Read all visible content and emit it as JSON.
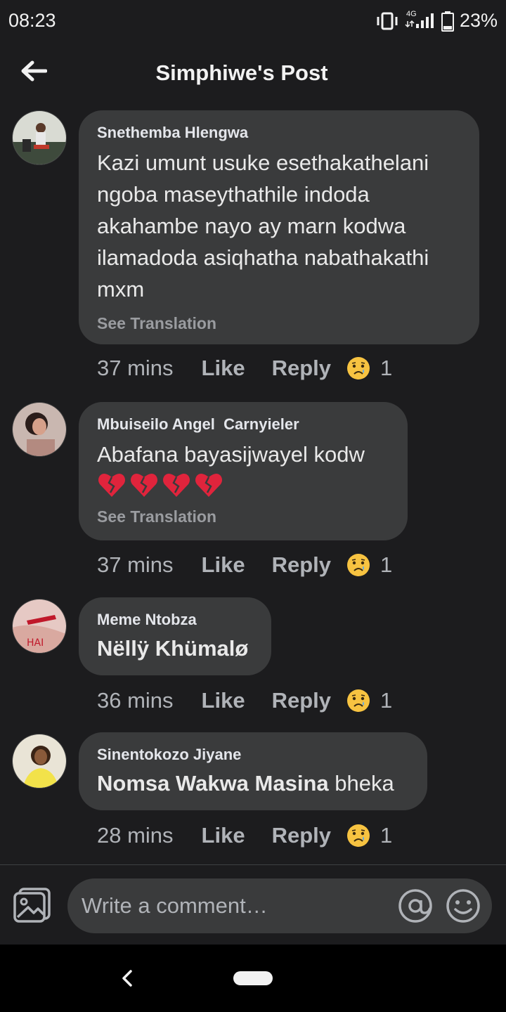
{
  "status": {
    "time": "08:23",
    "network": "4G",
    "battery": "23%"
  },
  "header": {
    "title": "Simphiwe's Post"
  },
  "comments": [
    {
      "author": "Snethemba Hlengwa",
      "text": "Kazi umunt usuke esethakathelani ngoba maseythathile indoda akahambe nayo ay marn kodwa ilamadoda asiqhatha nabathakathi mxm",
      "see_translation": "See Translation",
      "time": "37 mins",
      "like": "Like",
      "reply": "Reply",
      "reaction_count": "1",
      "reaction_icon": "sad-face-icon"
    },
    {
      "author": "Mbuiseilo Angel  Carnyieler",
      "text": "Abafana bayasijwayel kodw",
      "emojis": "💔💔💔💔",
      "see_translation": "See Translation",
      "time": "37 mins",
      "like": "Like",
      "reply": "Reply",
      "reaction_count": "1",
      "reaction_icon": "sad-face-icon"
    },
    {
      "author": "Meme Ntobza",
      "mention": "Nëllÿ Khümalø",
      "time": "36 mins",
      "like": "Like",
      "reply": "Reply",
      "reaction_count": "1",
      "reaction_icon": "sad-face-icon"
    },
    {
      "author": "Sinentokozo Jiyane",
      "mention": "Nomsa Wakwa Masina",
      "text": " bheka",
      "time": "28 mins",
      "like": "Like",
      "reply": "Reply",
      "reaction_count": "1",
      "reaction_icon": "sad-face-icon"
    }
  ],
  "composer": {
    "placeholder": "Write a comment…"
  },
  "colors": {
    "background": "#1c1c1e",
    "bubble": "#3a3b3c",
    "meta_text": "#b0b3b8"
  }
}
